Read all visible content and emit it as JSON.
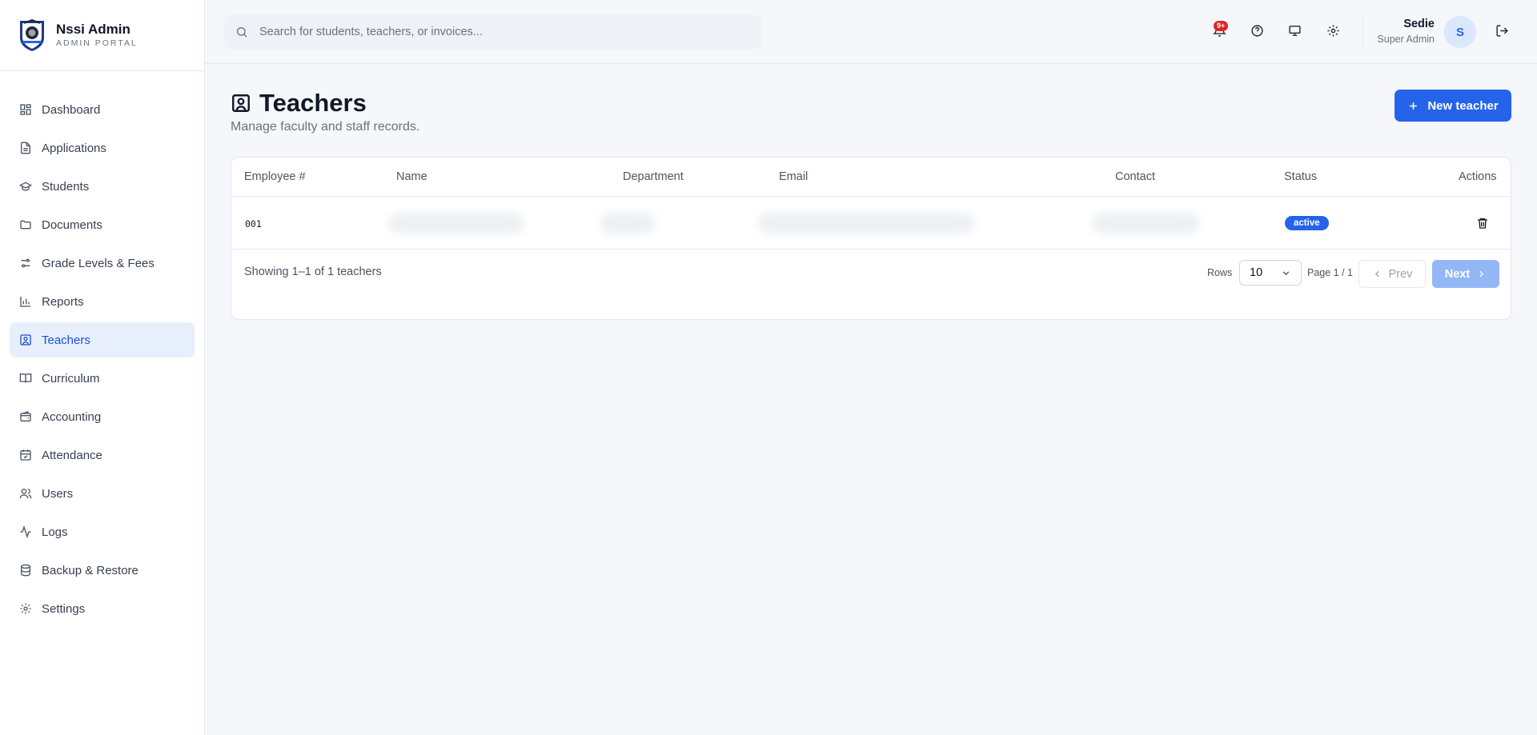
{
  "brand": {
    "title": "Nssi Admin",
    "subtitle": "ADMIN PORTAL",
    "logo_icon": "school-seal-logo"
  },
  "sidebar": {
    "items": [
      {
        "label": "Dashboard",
        "icon": "dashboard-icon"
      },
      {
        "label": "Applications",
        "icon": "file-text-icon"
      },
      {
        "label": "Students",
        "icon": "graduation-cap-icon"
      },
      {
        "label": "Documents",
        "icon": "folder-icon"
      },
      {
        "label": "Grade Levels & Fees",
        "icon": "sliders-icon"
      },
      {
        "label": "Reports",
        "icon": "bar-chart-icon"
      },
      {
        "label": "Teachers",
        "icon": "contact-icon",
        "active": true
      },
      {
        "label": "Curriculum",
        "icon": "book-open-icon"
      },
      {
        "label": "Accounting",
        "icon": "wallet-icon"
      },
      {
        "label": "Attendance",
        "icon": "calendar-check-icon"
      },
      {
        "label": "Users",
        "icon": "users-icon"
      },
      {
        "label": "Logs",
        "icon": "activity-icon"
      },
      {
        "label": "Backup & Restore",
        "icon": "database-icon"
      },
      {
        "label": "Settings",
        "icon": "gear-icon"
      }
    ]
  },
  "topbar": {
    "search_placeholder": "Search for students, teachers, or invoices...",
    "notification_badge": "9+",
    "user": {
      "name": "Sedie",
      "role": "Super Admin",
      "initial": "S"
    }
  },
  "page": {
    "title": "Teachers",
    "subtitle": "Manage faculty and staff records.",
    "new_button_label": "New teacher"
  },
  "table": {
    "columns": [
      "Employee #",
      "Name",
      "Department",
      "Email",
      "Contact",
      "Status",
      "Actions"
    ],
    "rows": [
      {
        "employee_no": "001",
        "status": "active"
      }
    ],
    "footer": {
      "showing": "Showing 1–1 of 1 teachers",
      "rows_label": "Rows",
      "rows_value": "10",
      "page_label": "Page 1 / 1",
      "prev_label": "Prev",
      "next_label": "Next"
    }
  },
  "colors": {
    "accent": "#2563eb",
    "active_nav_bg": "#e7effd",
    "badge": "#dc2626",
    "background": "#f5f7fb"
  }
}
